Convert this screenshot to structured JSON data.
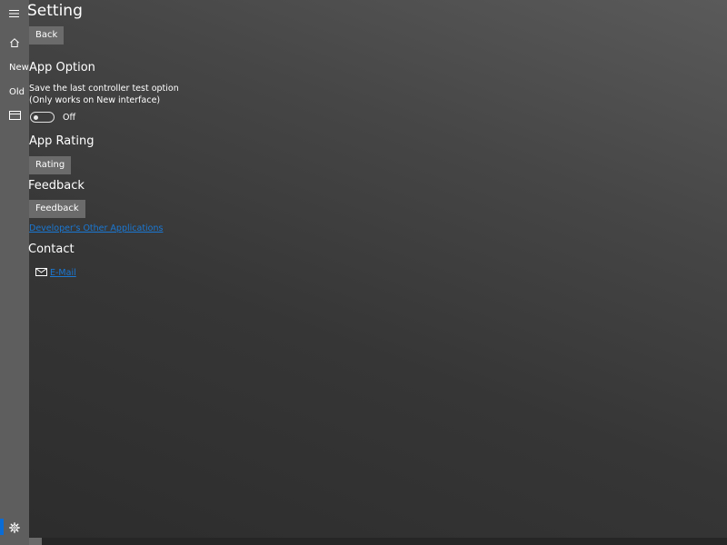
{
  "nav": {
    "new_label": "New",
    "old_label": "Old",
    "icons": [
      "hamburger-icon",
      "home-icon",
      "card-icon",
      "gear-icon"
    ]
  },
  "page": {
    "title": "Setting",
    "back_label": "Back"
  },
  "app_option": {
    "heading": "App Option",
    "desc_line1": "Save the last controller test option",
    "desc_line2": "(Only works on New interface)",
    "toggle_state": "Off"
  },
  "app_rating": {
    "heading": "App Rating",
    "button_label": "Rating"
  },
  "feedback": {
    "heading": "Feedback",
    "button_label": "Feedback",
    "other_apps_link": "Developer's Other Applications"
  },
  "contact": {
    "heading": "Contact",
    "email_link": "E-Mail"
  },
  "colors": {
    "accent": "#0a6cd6",
    "link": "#1a78d4",
    "rail": "#5e5e5e",
    "button": "#6b6b6b"
  }
}
